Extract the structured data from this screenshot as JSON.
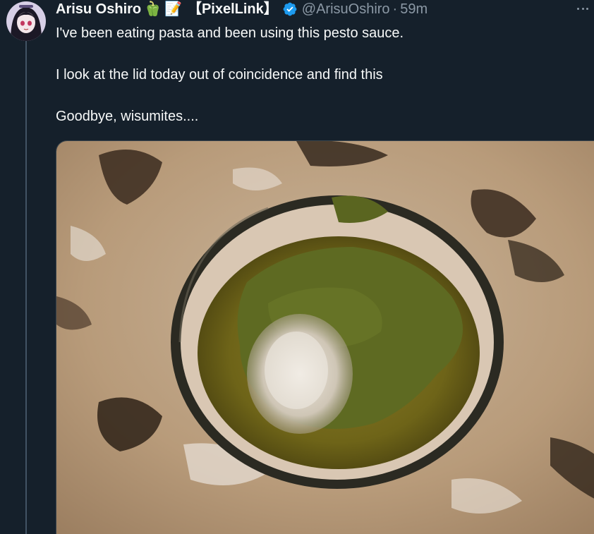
{
  "tweet": {
    "display_name": "Arisu Oshiro",
    "name_emoji_1": "🫑",
    "name_emoji_2": "📝",
    "org_tag": "【PixelLink】",
    "handle": "@ArisuOshiro",
    "separator": "·",
    "time": "59m",
    "paragraphs": [
      "I've been eating pasta and been using this pesto sauce.",
      "I look at the lid today out of coincidence and find this",
      "Goodbye, wisumites...."
    ]
  },
  "icons": {
    "verified": "verified-badge-icon",
    "more": "more-options-icon",
    "avatar": "avatar"
  },
  "colors": {
    "background": "#15202b",
    "text_primary": "#f7f9f9",
    "text_secondary": "#8b98a5",
    "verified": "#1d9bf0"
  }
}
